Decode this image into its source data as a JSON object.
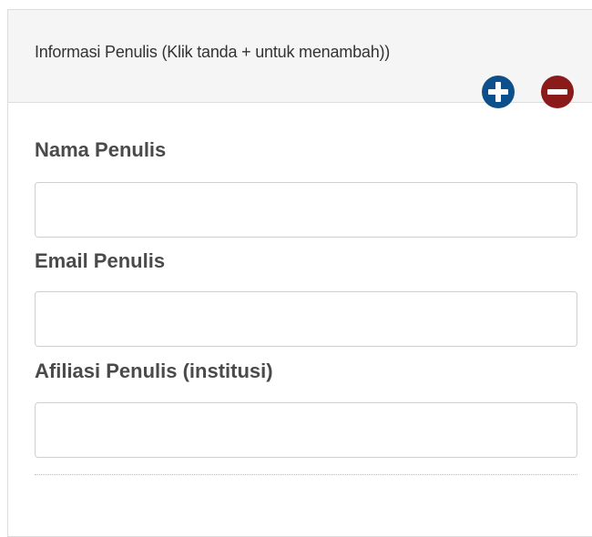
{
  "section": {
    "title": "Informasi Penulis (Klik tanda + untuk menambah))",
    "add_icon": "plus-circle-icon",
    "remove_icon": "minus-circle-icon",
    "colors": {
      "add": "#0d4f8b",
      "remove": "#8b1a1a"
    }
  },
  "form": {
    "name_label": "Nama Penulis",
    "name_value": "",
    "email_label": "Email Penulis",
    "email_value": "",
    "affiliation_label": "Afiliasi Penulis (institusi)",
    "affiliation_value": ""
  }
}
